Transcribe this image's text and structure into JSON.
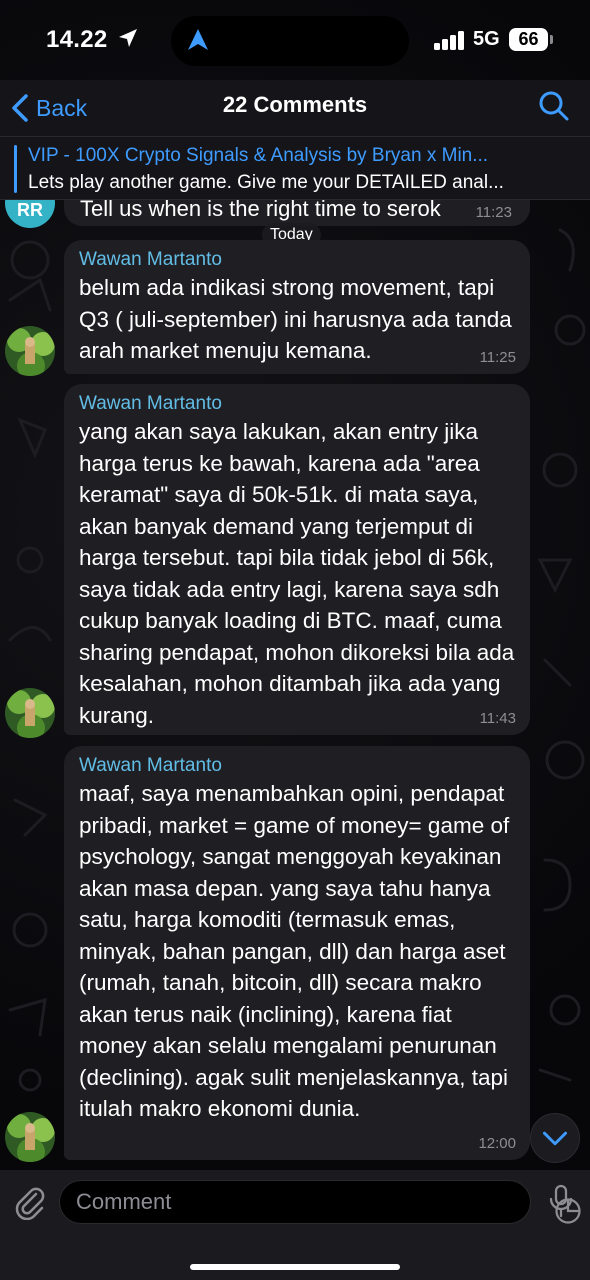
{
  "status_bar": {
    "time": "14.22",
    "network": "5G",
    "battery": "66"
  },
  "header": {
    "back_label": "Back",
    "title": "22 Comments"
  },
  "pinned": {
    "channel_title": "VIP - 100X Crypto Signals & Analysis by Bryan x Min...",
    "preview_text": "Lets play another game. Give me your DETAILED anal..."
  },
  "previous_message": {
    "avatar_initials": "RR",
    "text": "Tell us when is the right time to serok",
    "time": "11:23"
  },
  "date_separator": "Today",
  "messages": [
    {
      "sender": "Wawan Martanto",
      "text": "belum ada indikasi strong movement, tapi Q3 ( juli-september) ini harusnya ada tanda arah market menuju kemana.",
      "time": "11:25"
    },
    {
      "sender": "Wawan Martanto",
      "text": "yang akan saya lakukan, akan entry jika harga terus ke bawah, karena ada \"area keramat\" saya di 50k-51k. di mata saya, akan banyak demand yang terjemput di harga tersebut. tapi bila tidak jebol di 56k, saya tidak ada entry lagi, karena saya sdh cukup banyak loading di BTC. maaf, cuma sharing pendapat, mohon dikoreksi bila ada kesalahan, mohon ditambah jika ada yang kurang.",
      "time": "11:43"
    },
    {
      "sender": "Wawan Martanto",
      "text": "maaf, saya menambahkan opini, pendapat pribadi, market = game of money= game of psychology, sangat menggoyah keyakinan akan masa depan. yang saya tahu hanya satu, harga komoditi (termasuk emas, minyak, bahan pangan, dll) dan harga aset (rumah, tanah, bitcoin, dll) secara makro akan terus naik (inclining), karena fiat money akan selalu mengalami penurunan (declining). agak sulit menjelaskannya, tapi itulah makro ekonomi dunia.",
      "time": "12:00"
    }
  ],
  "input": {
    "placeholder": "Comment"
  },
  "icons": {
    "location": "location-arrow-icon",
    "back": "chevron-left-icon",
    "search": "search-icon",
    "attach": "paperclip-icon",
    "sticker": "sticker-icon",
    "mic": "microphone-icon",
    "scroll": "chevron-down-icon"
  },
  "colors": {
    "accent": "#3e9bff",
    "sender_name": "#62bde6",
    "bubble": "#1f1f23",
    "rr_avatar": "#34b3c6"
  }
}
